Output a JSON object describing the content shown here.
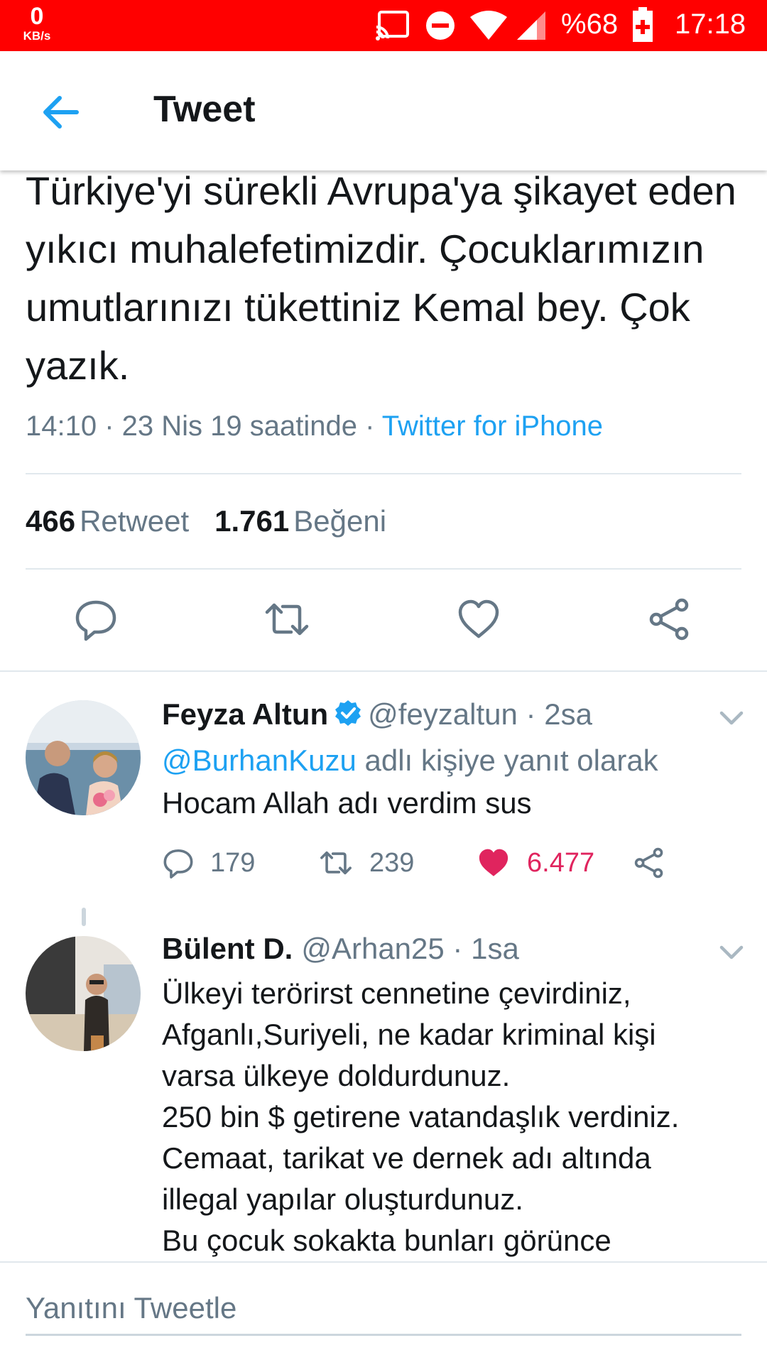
{
  "status_bar": {
    "net_speed_value": "0",
    "net_speed_unit": "KB/s",
    "battery_percent": "%68",
    "time": "17:18",
    "bar_color": "#ff0000"
  },
  "toolbar": {
    "title": "Tweet",
    "back_icon": "arrow-left-icon"
  },
  "tweet": {
    "text": "Türkiye'yi sürekli Avrupa'ya şikayet eden yıkıcı muhalefetimizdir. Çocuklarımızın umutlarınızı tükettiniz Kemal bey. Çok yazık.",
    "timestamp": "14:10 · 23 Nis 19 saatinde · ",
    "source": "Twitter for iPhone",
    "retweet_count": "466",
    "retweet_label": "Retweet",
    "like_count": "1.761",
    "like_label": "Beğeni",
    "actions": [
      "reply-icon",
      "retweet-icon",
      "heart-icon",
      "share-icon"
    ]
  },
  "replies": [
    {
      "name": "Feyza Altun",
      "handle": "@feyzaltun",
      "time": " · 2sa",
      "verified": true,
      "reply_to_mention": "@BurhanKuzu",
      "reply_to_suffix": " adlı kişiye yanıt olarak",
      "text": "Hocam Allah adı verdim sus",
      "reply_count": "179",
      "retweet_count": "239",
      "like_count": "6.477",
      "liked": true
    },
    {
      "name": "Bülent D.",
      "handle": "@Arhan25",
      "time": " · 1sa",
      "verified": false,
      "text_lines": [
        "Ülkeyi terörirst cennetine çevirdiniz,",
        "Afganlı,Suriyeli, ne kadar kriminal kişi",
        "varsa ülkeye doldurdunuz.",
        "250 bin $ getirene vatandaşlık verdiniz.",
        "Cemaat, tarikat ve dernek adı altında",
        "illegal yapılar oluşturdunuz.",
        "Bu çocuk sokakta bunları görünce"
      ]
    }
  ],
  "compose": {
    "placeholder": "Yanıtını Tweetle"
  },
  "colors": {
    "accent": "#1da1f2",
    "like": "#e0245e",
    "muted": "#657786",
    "text": "#14171a"
  }
}
